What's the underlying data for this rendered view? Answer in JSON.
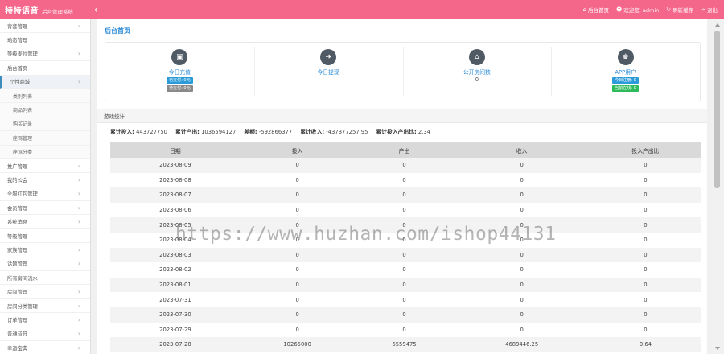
{
  "header": {
    "brand": "特特语音",
    "subtitle": "后台管理系统",
    "collapse_icon": "chevron-left-icon",
    "links": [
      {
        "icon": "home-icon",
        "label": "后台首页"
      },
      {
        "icon": "users-icon",
        "label": "欢迎您, admin"
      },
      {
        "icon": "refresh-icon",
        "label": "刷新缓存"
      },
      {
        "icon": "logout-icon",
        "label": "退出"
      }
    ],
    "color": "#f4668a"
  },
  "sidebar": {
    "items": [
      {
        "label": "背套管理",
        "arrow": "›"
      },
      {
        "label": "动态管理",
        "arrow": ""
      },
      {
        "label": "等级麦位管理",
        "arrow": "›"
      },
      {
        "label": "后台首页",
        "arrow": ""
      },
      {
        "label": "个性商城",
        "arrow": "›"
      },
      {
        "label": "类别列表",
        "arrow": ""
      },
      {
        "label": "商品列表",
        "arrow": ""
      },
      {
        "label": "购买记录",
        "arrow": ""
      },
      {
        "label": "座驾管理",
        "arrow": ""
      },
      {
        "label": "座驾分类",
        "arrow": ""
      },
      {
        "label": "推广管理",
        "arrow": "›"
      },
      {
        "label": "我的公会",
        "arrow": "›"
      },
      {
        "label": "全服红包管理",
        "arrow": "›"
      },
      {
        "label": "会员管理",
        "arrow": "›"
      },
      {
        "label": "系统消息",
        "arrow": "›"
      },
      {
        "label": "等级管理",
        "arrow": ""
      },
      {
        "label": "家族管理",
        "arrow": "›"
      },
      {
        "label": "话题管理",
        "arrow": "›"
      },
      {
        "label": "所有房间流水",
        "arrow": ""
      },
      {
        "label": "房间管理",
        "arrow": "›"
      },
      {
        "label": "房间分类管理",
        "arrow": "›"
      },
      {
        "label": "订单管理",
        "arrow": "›"
      },
      {
        "label": "普通音符",
        "arrow": "›"
      },
      {
        "label": "幸运宝典",
        "arrow": "›"
      }
    ]
  },
  "main": {
    "title": "后台首页",
    "cards": [
      {
        "icon": "money-icon",
        "label": "今日充值",
        "value": "",
        "badges": [
          {
            "text": "已支付: 0元",
            "color": "blue"
          },
          {
            "text": "待支付: 0元",
            "color": "gray"
          }
        ]
      },
      {
        "icon": "withdraw-icon",
        "label": "今日提现",
        "value": "",
        "badges": []
      },
      {
        "icon": "house-icon",
        "label": "公开房间数",
        "value": "0",
        "badges": []
      },
      {
        "icon": "user-icon",
        "label": "APP用户",
        "value": "",
        "badges": [
          {
            "text": "今日注册: 0",
            "color": "blue"
          },
          {
            "text": "当前在线: 0",
            "color": "green"
          }
        ]
      }
    ],
    "section_title": "游戏统计",
    "summary": [
      {
        "key": "累计投入:",
        "value": "443727750"
      },
      {
        "key": "累计产出:",
        "value": "1036594127"
      },
      {
        "key": "差额:",
        "value": "-592866377"
      },
      {
        "key": "累计收入:",
        "value": "-437377257.95"
      },
      {
        "key": "累计投入产出比:",
        "value": "2.34"
      }
    ],
    "table": {
      "headers": [
        "日期",
        "投入",
        "产出",
        "收入",
        "投入产出比"
      ],
      "rows": [
        [
          "2023-08-09",
          "0",
          "0",
          "0",
          "0"
        ],
        [
          "2023-08-08",
          "0",
          "0",
          "0",
          "0"
        ],
        [
          "2023-08-07",
          "0",
          "0",
          "0",
          "0"
        ],
        [
          "2023-08-06",
          "0",
          "0",
          "0",
          "0"
        ],
        [
          "2023-08-05",
          "0",
          "0",
          "0",
          "0"
        ],
        [
          "2023-08-04",
          "0",
          "0",
          "0",
          "0"
        ],
        [
          "2023-08-03",
          "0",
          "0",
          "0",
          "0"
        ],
        [
          "2023-08-02",
          "0",
          "0",
          "0",
          "0"
        ],
        [
          "2023-08-01",
          "0",
          "0",
          "0",
          "0"
        ],
        [
          "2023-07-31",
          "0",
          "0",
          "0",
          "0"
        ],
        [
          "2023-07-30",
          "0",
          "0",
          "0",
          "0"
        ],
        [
          "2023-07-29",
          "0",
          "0",
          "0",
          "0"
        ],
        [
          "2023-07-28",
          "10265000",
          "6559475",
          "4689446.25",
          "0.64"
        ]
      ]
    }
  },
  "watermark": "https://www.huzhan.com/ishop44131"
}
